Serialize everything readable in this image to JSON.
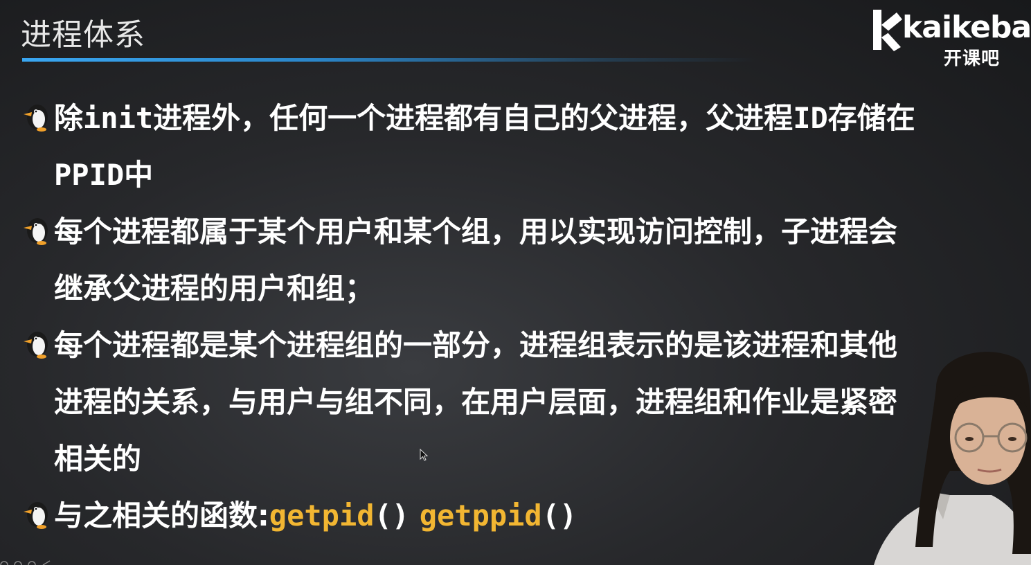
{
  "slide": {
    "title": "进程体系",
    "logo": {
      "wordmark": "kaikeba",
      "chinese": "开课吧"
    },
    "bullets": [
      {
        "parts": [
          {
            "text": "除",
            "style": "normal"
          },
          {
            "text": "init",
            "style": "mono"
          },
          {
            "text": "进程外，任何一个进程都有自己的父进程，父进程",
            "style": "normal"
          },
          {
            "text": "ID",
            "style": "mono"
          },
          {
            "text": "存储在",
            "style": "normal"
          }
        ],
        "line2_parts": [
          {
            "text": "PPID",
            "style": "mono"
          },
          {
            "text": "中",
            "style": "normal"
          }
        ]
      },
      {
        "line1": "每个进程都属于某个用户和某个组，用以实现访问控制，子进程会",
        "line2": "继承父进程的用户和组；"
      },
      {
        "line1": "每个进程都是某个进程组的一部分，进程组表示的是该进程和其他",
        "line2": "进程的关系，与用户与组不同，在用户层面，进程组和作业是紧密",
        "line3": "相关的"
      },
      {
        "label": "与之相关的函数:",
        "func1": "getpid",
        "func2": "getppid",
        "parens": "()"
      }
    ]
  },
  "icons": {
    "bullet": "penguin-icon",
    "cursor": "mouse-cursor-icon",
    "logo": "kaikeba-logo"
  },
  "colors": {
    "accent_rule": "#3aa7f2",
    "code": "#f2b632",
    "text": "#ffffff",
    "background": "#232427"
  }
}
